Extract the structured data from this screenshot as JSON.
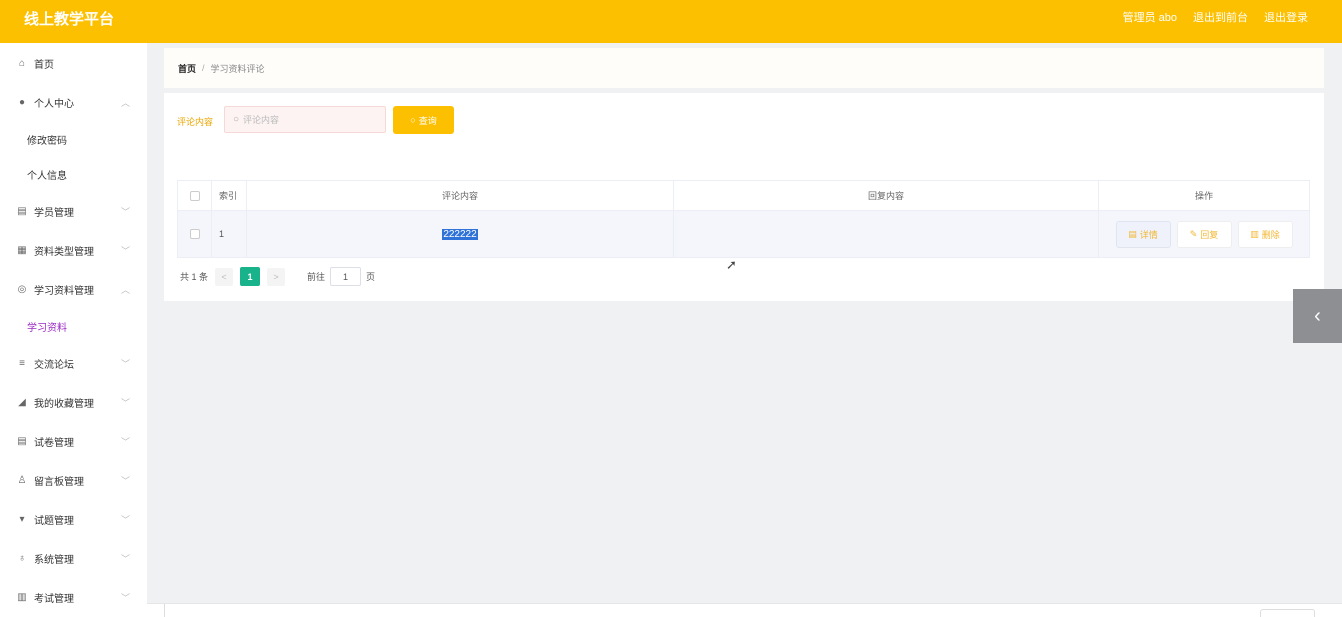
{
  "header": {
    "brand": "线上教学平台",
    "admin": "管理员 abo",
    "front": "退出到前台",
    "logout": "退出登录"
  },
  "sidebar": {
    "items": [
      {
        "label": "首页",
        "icon": "home-icon",
        "glyph": "⌂"
      },
      {
        "label": "个人中心",
        "icon": "user-icon",
        "glyph": "👤",
        "arrow": "^"
      },
      {
        "label": "修改密码"
      },
      {
        "label": "个人信息"
      },
      {
        "label": "学员管理",
        "icon": "clipboard-icon",
        "glyph": "▤",
        "arrow": "v"
      },
      {
        "label": "资料类型管理",
        "icon": "grid-icon",
        "glyph": "▦",
        "arrow": "v"
      },
      {
        "label": "学习资料管理",
        "icon": "globe-icon",
        "glyph": "◎",
        "arrow": "^"
      },
      {
        "label": "学习资料"
      },
      {
        "label": "交流论坛",
        "icon": "list-icon",
        "glyph": "≡",
        "arrow": "v"
      },
      {
        "label": "我的收藏管理",
        "icon": "thumb-icon",
        "glyph": "◢",
        "arrow": "v"
      },
      {
        "label": "试卷管理",
        "icon": "document-icon",
        "glyph": "▤",
        "arrow": "v"
      },
      {
        "label": "留言板管理",
        "icon": "person-icon",
        "glyph": "♙",
        "arrow": "v"
      },
      {
        "label": "试题管理",
        "icon": "flag-icon",
        "glyph": "▾",
        "arrow": "v"
      },
      {
        "label": "系统管理",
        "icon": "bulb-icon",
        "glyph": "♁",
        "arrow": "v"
      },
      {
        "label": "考试管理",
        "icon": "chart-icon",
        "glyph": "▥",
        "arrow": "v"
      }
    ]
  },
  "breadcrumb": {
    "home": "首页",
    "sep": "/",
    "current": "学习资料评论"
  },
  "search": {
    "label": "评论内容",
    "placeholder": "评论内容",
    "button": "查询"
  },
  "table": {
    "headers": {
      "index": "索引",
      "content": "评论内容",
      "reply": "回复内容",
      "ops": "操作"
    },
    "rows": [
      {
        "index": "1",
        "content": "222222",
        "reply": ""
      }
    ],
    "actions": {
      "detail": "详情",
      "reply": "回复",
      "delete": "删除"
    }
  },
  "pager": {
    "total": "共 1 条",
    "prev": "<",
    "page": "1",
    "next": ">",
    "goto_label": "前往",
    "goto_value": "1",
    "goto_unit": "页"
  },
  "side_toggle": "‹"
}
